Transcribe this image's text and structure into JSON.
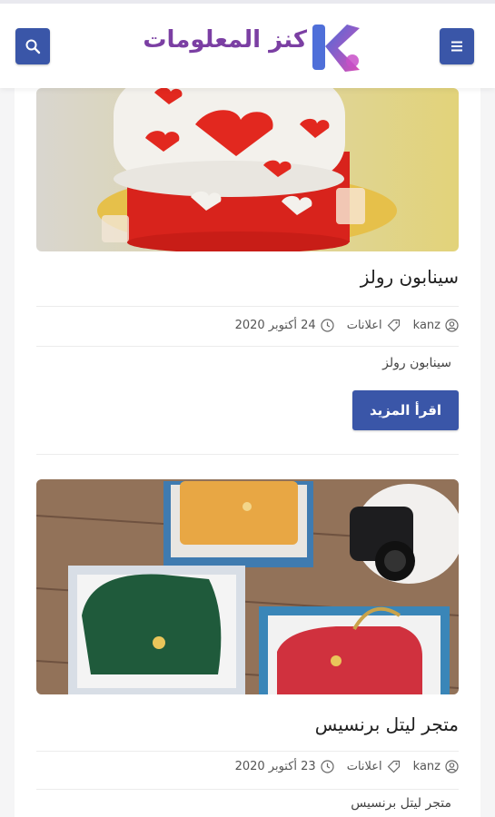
{
  "header": {
    "logo_text": "كنز المعلومات",
    "logo_letter": "K",
    "search_icon": "search-icon",
    "menu_icon": "hamburger-menu-icon"
  },
  "colors": {
    "primary": "#3a56a8",
    "logo_purple": "#7b3fa3",
    "logo_pink": "#d94fb8"
  },
  "posts": [
    {
      "title": "سينابون رولز",
      "author": "kanz",
      "category": "اعلانات",
      "date": "24 أكتوبر 2020",
      "excerpt": "سينابون رولز",
      "read_more": "اقرأ المزيد",
      "image": "heart-decorated-cake"
    },
    {
      "title": "متجر ليتل برنسيس",
      "author": "kanz",
      "category": "اعلانات",
      "date": "23 أكتوبر 2020",
      "excerpt": "متجر ليتل برنسيس",
      "image": "handbags-in-gift-boxes"
    }
  ]
}
